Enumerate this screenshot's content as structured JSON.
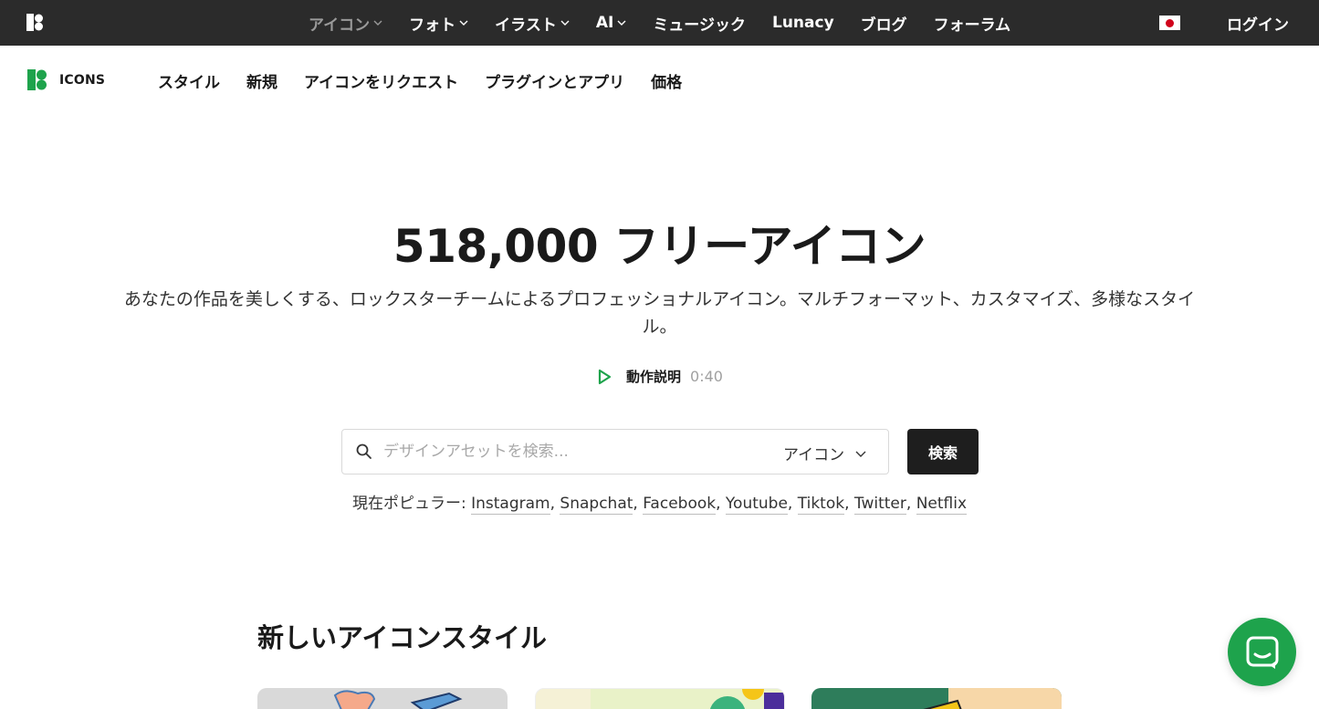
{
  "topbar": {
    "nav": [
      {
        "label": "アイコン",
        "dropdown": true,
        "active": true
      },
      {
        "label": "フォト",
        "dropdown": true,
        "active": false
      },
      {
        "label": "イラスト",
        "dropdown": true,
        "active": false
      },
      {
        "label": "AI",
        "dropdown": true,
        "active": false
      },
      {
        "label": "ミュージック",
        "dropdown": false,
        "active": false
      },
      {
        "label": "Lunacy",
        "dropdown": false,
        "active": false
      },
      {
        "label": "ブログ",
        "dropdown": false,
        "active": false
      },
      {
        "label": "フォーラム",
        "dropdown": false,
        "active": false
      }
    ],
    "login_label": "ログイン",
    "flag_icon": "japan-flag-icon"
  },
  "subbar": {
    "brand_text": "ICONS",
    "nav": [
      "スタイル",
      "新規",
      "アイコンをリクエスト",
      "プラグインとアプリ",
      "価格"
    ]
  },
  "hero": {
    "title": "518,000 フリーアイコン",
    "description": "あなたの作品を美しくする、ロックスターチームによるプロフェッショナルアイコン。マルチフォーマット、カスタマイズ、多様なスタイル。",
    "video_label": "動作説明",
    "video_duration": "0:40"
  },
  "search": {
    "placeholder": "デザインアセットを検索...",
    "type_label": "アイコン",
    "button_label": "検索"
  },
  "popular": {
    "prefix": "現在ポピュラー:",
    "items": [
      "Instagram",
      "Snapchat",
      "Facebook",
      "Youtube",
      "Tiktok",
      "Twitter",
      "Netflix"
    ]
  },
  "section": {
    "title": "新しいアイコンスタイル"
  },
  "colors": {
    "topbar_bg": "#2b2b2b",
    "brand_green": "#1ea34c",
    "button_dark": "#1e1e1e"
  }
}
